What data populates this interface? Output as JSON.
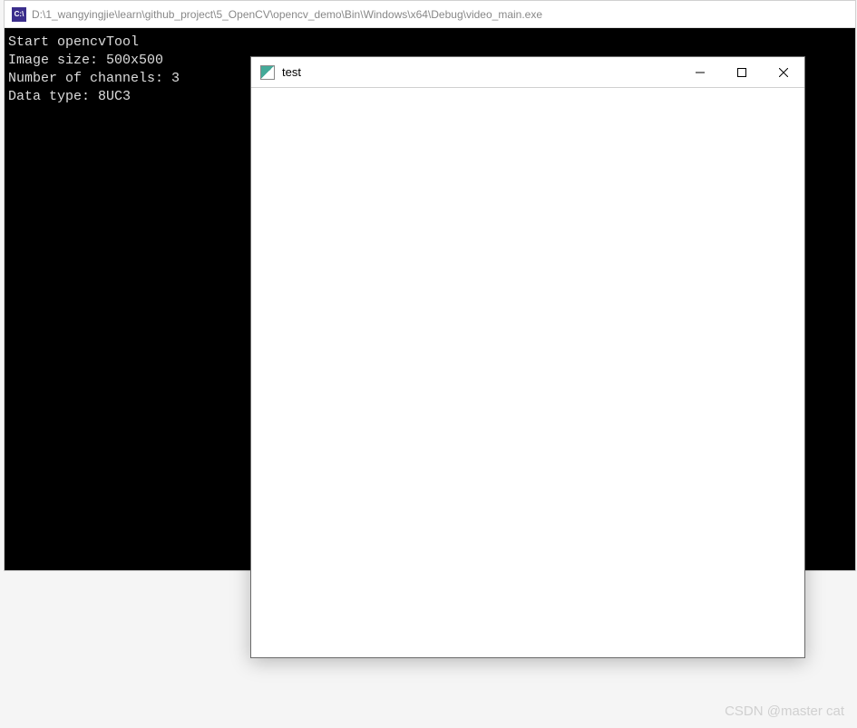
{
  "console": {
    "icon_label": "C:\\",
    "title": "D:\\1_wangyingjie\\learn\\github_project\\5_OpenCV\\opencv_demo\\Bin\\Windows\\x64\\Debug\\video_main.exe",
    "output": {
      "line1": "Start opencvTool",
      "line2": "Image size: 500x500",
      "line3": "Number of channels: 3",
      "line4": "Data type: 8UC3"
    }
  },
  "test_window": {
    "title": "test"
  },
  "watermark": "CSDN @master cat"
}
